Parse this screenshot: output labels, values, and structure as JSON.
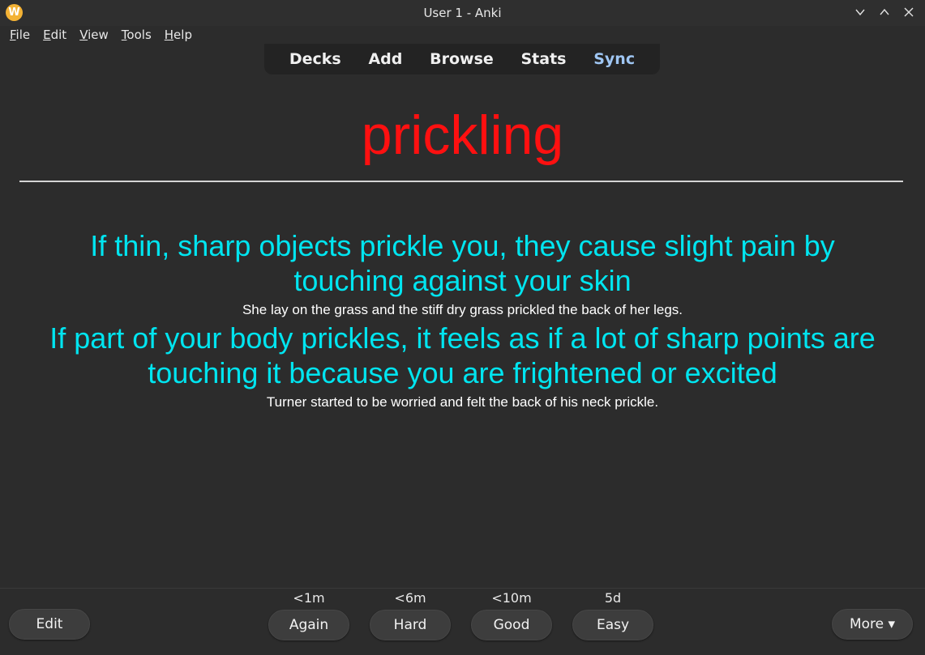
{
  "window": {
    "title": "User 1 - Anki",
    "app_icon_letter": "W"
  },
  "menu": {
    "items": [
      {
        "accel": "F",
        "rest": "ile"
      },
      {
        "accel": "E",
        "rest": "dit"
      },
      {
        "accel": "V",
        "rest": "iew"
      },
      {
        "accel": "T",
        "rest": "ools"
      },
      {
        "accel": "H",
        "rest": "elp"
      }
    ]
  },
  "topnav": {
    "decks": "Decks",
    "add": "Add",
    "browse": "Browse",
    "stats": "Stats",
    "sync": "Sync"
  },
  "card": {
    "front": "prickling",
    "definitions": [
      {
        "line1": "If thin, sharp objects prickle you, they cause slight pain by",
        "line2": "touching against your skin",
        "example": "She lay on the grass and the stiff dry grass prickled the back of her legs."
      },
      {
        "line1": "If part of your body prickles, it feels as if a lot of sharp points are",
        "line2": "touching it because you are frightened or excited",
        "example": "Turner started to be worried and felt the back of his neck prickle."
      }
    ]
  },
  "bottom": {
    "edit": "Edit",
    "more": "More ▾",
    "answers": [
      {
        "time": "<1m",
        "label": "Again"
      },
      {
        "time": "<6m",
        "label": "Hard"
      },
      {
        "time": "<10m",
        "label": "Good"
      },
      {
        "time": "5d",
        "label": "Easy"
      }
    ]
  },
  "colors": {
    "front_word": "#ff1010",
    "definition": "#00e5f0",
    "sync_link": "#9fc6f3",
    "background": "#2c2c2c"
  }
}
